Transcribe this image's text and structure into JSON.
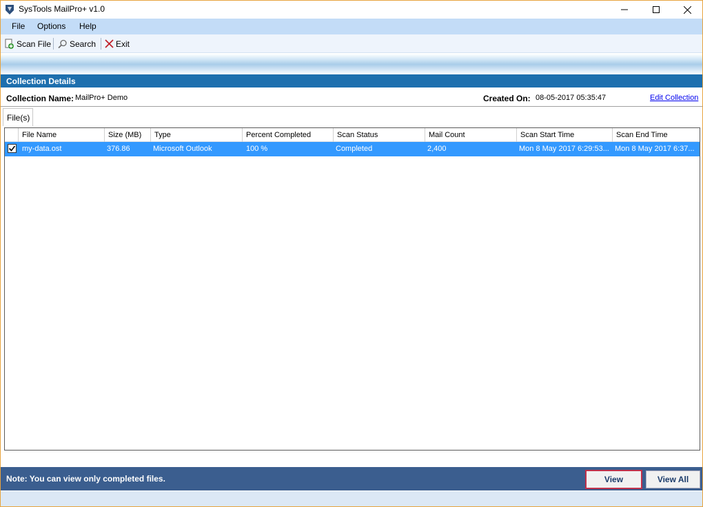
{
  "window": {
    "title": "SysTools MailPro+ v1.0"
  },
  "menu": {
    "items": [
      "File",
      "Options",
      "Help"
    ]
  },
  "toolbar": {
    "scan_file": "Scan File",
    "search": "Search",
    "exit": "Exit"
  },
  "collection": {
    "header": "Collection Details",
    "name_label": "Collection Name:",
    "name_value": "MailPro+ Demo",
    "created_label": "Created On:",
    "created_value": "08-05-2017 05:35:47",
    "edit_link": "Edit Collection"
  },
  "tab": {
    "label": "File(s)"
  },
  "grid": {
    "columns": [
      "File Name",
      "Size (MB)",
      "Type",
      "Percent Completed",
      "Scan Status",
      "Mail Count",
      "Scan Start Time",
      "Scan End Time"
    ],
    "rows": [
      {
        "checked": true,
        "file_name": "my-data.ost",
        "size": "376.86",
        "type": "Microsoft Outlook",
        "percent": "100 %",
        "status": "Completed",
        "mail_count": "2,400",
        "start_time": "Mon 8 May 2017 6:29:53...",
        "end_time": "Mon 8 May 2017 6:37..."
      }
    ]
  },
  "footer": {
    "note": "Note: You can view only completed files.",
    "view_button": "View",
    "view_all_button": "View All"
  },
  "colors": {
    "accent_header": "#1d6fae",
    "selection": "#3399ff",
    "footer_bar": "#3b5e8f",
    "menu_bar": "#c3dcf7"
  }
}
